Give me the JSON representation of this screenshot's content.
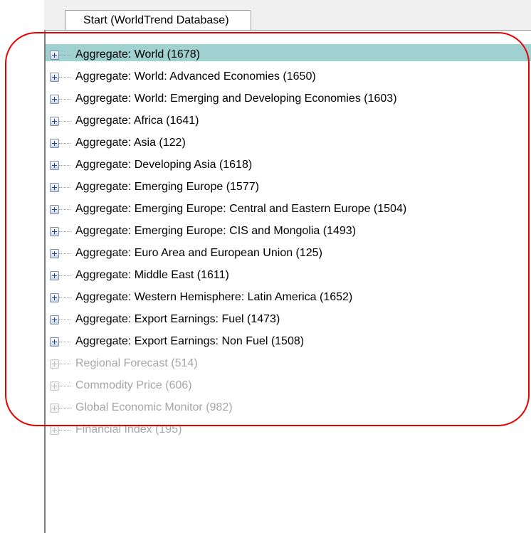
{
  "tab": {
    "label": "Start (WorldTrend Database)"
  },
  "tree": {
    "items": [
      {
        "label": "Aggregate: World (1678)",
        "selected": true,
        "disabled": false
      },
      {
        "label": "Aggregate: World: Advanced Economies (1650)",
        "selected": false,
        "disabled": false
      },
      {
        "label": "Aggregate: World: Emerging and Developing Economies (1603)",
        "selected": false,
        "disabled": false
      },
      {
        "label": "Aggregate: Africa (1641)",
        "selected": false,
        "disabled": false
      },
      {
        "label": "Aggregate: Asia (122)",
        "selected": false,
        "disabled": false
      },
      {
        "label": "Aggregate: Developing Asia (1618)",
        "selected": false,
        "disabled": false
      },
      {
        "label": "Aggregate: Emerging Europe (1577)",
        "selected": false,
        "disabled": false
      },
      {
        "label": "Aggregate: Emerging Europe: Central and Eastern Europe (1504)",
        "selected": false,
        "disabled": false
      },
      {
        "label": "Aggregate: Emerging Europe: CIS and Mongolia (1493)",
        "selected": false,
        "disabled": false
      },
      {
        "label": "Aggregate: Euro Area and European Union (125)",
        "selected": false,
        "disabled": false
      },
      {
        "label": "Aggregate: Middle East (1611)",
        "selected": false,
        "disabled": false
      },
      {
        "label": "Aggregate: Western Hemisphere: Latin America (1652)",
        "selected": false,
        "disabled": false
      },
      {
        "label": "Aggregate: Export Earnings: Fuel (1473)",
        "selected": false,
        "disabled": false
      },
      {
        "label": "Aggregate: Export Earnings: Non Fuel (1508)",
        "selected": false,
        "disabled": false
      },
      {
        "label": "Regional Forecast (514)",
        "selected": false,
        "disabled": true
      },
      {
        "label": "Commodity Price (606)",
        "selected": false,
        "disabled": true
      },
      {
        "label": "Global Economic Monitor (982)",
        "selected": false,
        "disabled": true
      },
      {
        "label": "Financial Index (195)",
        "selected": false,
        "disabled": true
      }
    ]
  },
  "colors": {
    "selection": "#9fd1d1",
    "annotation": "#e60000",
    "disabled_text": "#a6a6a6"
  },
  "icons": {
    "expander": "plus-box-icon"
  }
}
